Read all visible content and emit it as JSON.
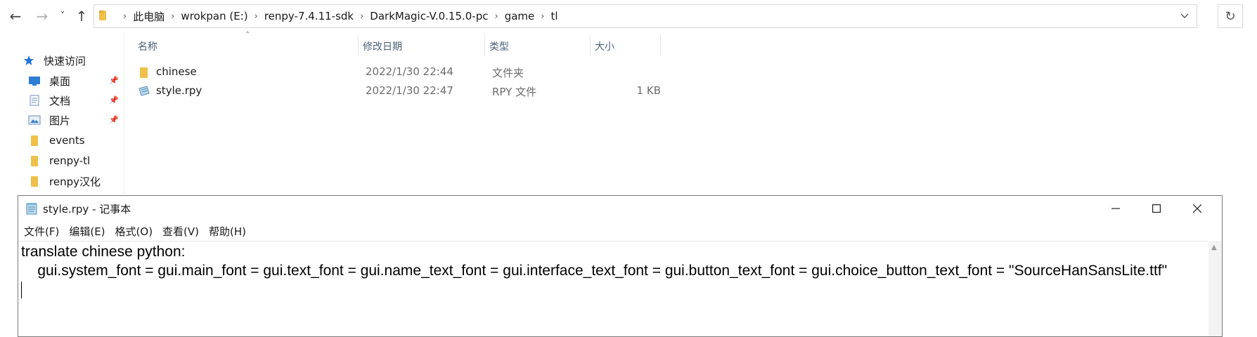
{
  "explorer": {
    "nav_back": "←",
    "nav_forward": "→",
    "nav_recent": "˅",
    "nav_up": "↑",
    "breadcrumb": [
      "此电脑",
      "wrokpan (E:)",
      "renpy-7.4.11-sdk",
      "DarkMagic-V.0.15.0-pc",
      "game",
      "tl"
    ],
    "sidebar": {
      "quick_access": "快速访问",
      "items": [
        {
          "label": "桌面",
          "icon": "desktop-icon",
          "pinned": true
        },
        {
          "label": "文档",
          "icon": "document-icon",
          "pinned": true
        },
        {
          "label": "图片",
          "icon": "picture-icon",
          "pinned": true
        },
        {
          "label": "events",
          "icon": "folder-icon",
          "pinned": false
        },
        {
          "label": "renpy-tl",
          "icon": "folder-icon",
          "pinned": false
        },
        {
          "label": "renpy汉化",
          "icon": "folder-icon",
          "pinned": false
        }
      ]
    },
    "columns": {
      "name": "名称",
      "date": "修改日期",
      "type": "类型",
      "size": "大小"
    },
    "files": [
      {
        "name": "chinese",
        "date": "2022/1/30 22:44",
        "type": "文件夹",
        "size": ""
      },
      {
        "name": "style.rpy",
        "date": "2022/1/30 22:47",
        "type": "RPY 文件",
        "size": "1 KB"
      }
    ]
  },
  "notepad": {
    "title": "style.rpy - 记事本",
    "menu": [
      "文件(F)",
      "编辑(E)",
      "格式(O)",
      "查看(V)",
      "帮助(H)"
    ],
    "lines": [
      "translate chinese python:",
      "    gui.system_font = gui.main_font = gui.text_font = gui.name_text_font = gui.interface_text_font = gui.button_text_font = gui.choice_button_text_font = \"SourceHanSansLite.ttf\""
    ]
  },
  "colors": {
    "folder": "#f0c04a",
    "accent": "#1e73d8",
    "header_text": "#4c607a"
  }
}
